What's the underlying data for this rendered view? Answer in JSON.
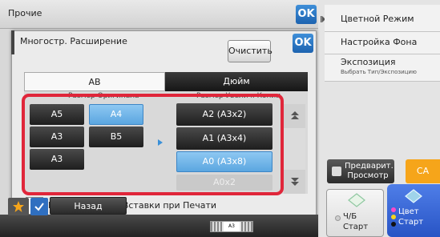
{
  "back_panel": {
    "title": "Прочие",
    "ok_label": "OK"
  },
  "right_menu": {
    "color_mode": "Цветной Режим",
    "background": "Настройка Фона",
    "exposure": "Экспозиция",
    "exposure_sub": "Выбрать Тип/Экспозицию",
    "preview": "Предварит. Просмотр",
    "ca": "CA",
    "bw_start_line1": "Ч/Б",
    "bw_start_line2": "Старт",
    "color_start_line1": "Цвет",
    "color_start_line2": "Старт"
  },
  "dialog": {
    "title": "Многостр. Расширение",
    "ok_label": "OK",
    "clear_label": "Очистить",
    "tabs": [
      "AB",
      "Дюйм"
    ],
    "original_size_header": "Размер Оригинала",
    "output_size_header": "Размер Увелич. Копии",
    "original_sizes": [
      "A5",
      "A4",
      "A3",
      "B5",
      "A3"
    ],
    "output_sizes": [
      "A2 (A3x2)",
      "A1 (A3x4)",
      "A0 (A3x8)",
      "A0x2"
    ],
    "checkbox_label": "Метка Позиции Вставки при Печати"
  },
  "bottom_bar": {
    "back_label": "Назад",
    "paper_label": "A3"
  }
}
